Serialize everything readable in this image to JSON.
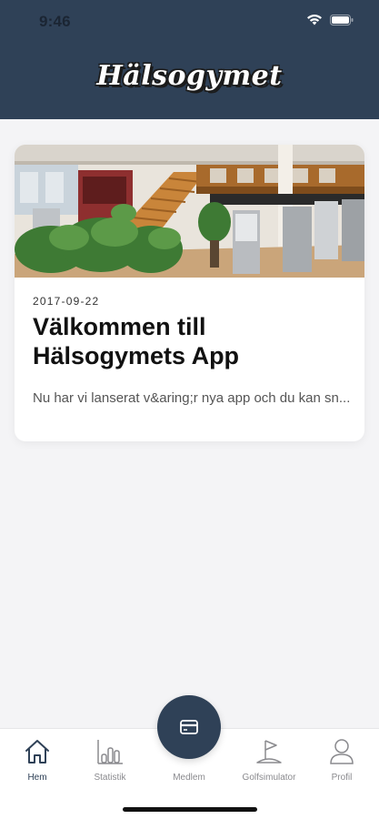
{
  "status_bar": {
    "time": "9:46"
  },
  "header": {
    "brand": "Hälsogymet"
  },
  "news": [
    {
      "date": "2017-09-22",
      "title": "Välkommen till Hälsogymets App",
      "excerpt": "Nu har vi lanserat v&aring;r nya app och du kan sn..."
    }
  ],
  "tabs": {
    "home": {
      "label": "Hem",
      "icon": "home-icon"
    },
    "stats": {
      "label": "Statistik",
      "icon": "bar-chart-icon"
    },
    "member": {
      "label": "Medlem",
      "icon": "card-icon"
    },
    "golf": {
      "label": "Golfsimulator",
      "icon": "golf-flag-icon"
    },
    "profile": {
      "label": "Profil",
      "icon": "person-icon"
    }
  },
  "colors": {
    "header_bg": "#2f4157",
    "fab_bg": "#2f4157",
    "tab_inactive": "#8a8a8e"
  }
}
